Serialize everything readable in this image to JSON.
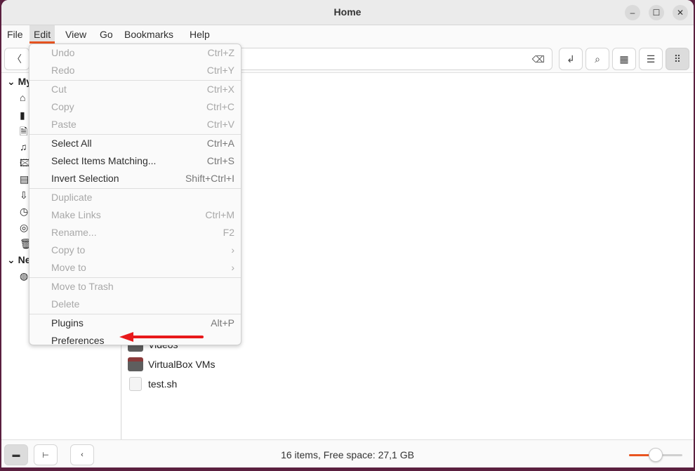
{
  "window": {
    "title": "Home"
  },
  "window_controls": {
    "minimize": "–",
    "maximize": "☐",
    "close": "✕"
  },
  "menubar": [
    "File",
    "Edit",
    "View",
    "Go",
    "Bookmarks",
    "Help"
  ],
  "active_menu": "Edit",
  "toolbar": {
    "back": "〈",
    "clear": "⌫",
    "open_terminal": "↲",
    "search": "⌕",
    "icon_view": "▦",
    "list_view": "☰",
    "compact_view": "⠿"
  },
  "sidebar": {
    "sections": [
      "My Computer",
      "Network"
    ],
    "section_short": [
      "My",
      "Ne"
    ],
    "icons": [
      "⌂",
      "▮",
      "🗎",
      "♫",
      "🖾",
      "▤",
      "⇩",
      "◷",
      "◎",
      "🗑"
    ],
    "network_icon": "◍"
  },
  "edit_menu": {
    "groups": [
      [
        {
          "label": "Undo",
          "accel": "Ctrl+Z",
          "enabled": false
        },
        {
          "label": "Redo",
          "accel": "Ctrl+Y",
          "enabled": false
        }
      ],
      [
        {
          "label": "Cut",
          "accel": "Ctrl+X",
          "enabled": false
        },
        {
          "label": "Copy",
          "accel": "Ctrl+C",
          "enabled": false
        },
        {
          "label": "Paste",
          "accel": "Ctrl+V",
          "enabled": false
        }
      ],
      [
        {
          "label": "Select All",
          "accel": "Ctrl+A",
          "enabled": true
        },
        {
          "label": "Select Items Matching...",
          "accel": "Ctrl+S",
          "enabled": true
        },
        {
          "label": "Invert Selection",
          "accel": "Shift+Ctrl+I",
          "enabled": true
        }
      ],
      [
        {
          "label": "Duplicate",
          "accel": "",
          "enabled": false
        },
        {
          "label": "Make Links",
          "accel": "Ctrl+M",
          "enabled": false
        },
        {
          "label": "Rename...",
          "accel": "F2",
          "enabled": false
        },
        {
          "label": "Copy to",
          "accel": "›",
          "enabled": false
        },
        {
          "label": "Move to",
          "accel": "›",
          "enabled": false
        }
      ],
      [
        {
          "label": "Move to Trash",
          "accel": "",
          "enabled": false
        },
        {
          "label": "Delete",
          "accel": "",
          "enabled": false
        }
      ],
      [
        {
          "label": "Plugins",
          "accel": "Alt+P",
          "enabled": true
        },
        {
          "label": "Preferences",
          "accel": "",
          "enabled": true
        }
      ]
    ]
  },
  "files": [
    {
      "name": "Videos",
      "type": "folder"
    },
    {
      "name": "VirtualBox VMs",
      "type": "folder"
    },
    {
      "name": "test.sh",
      "type": "script"
    }
  ],
  "statusbar": {
    "text": "16 items, Free space: 27,1 GB",
    "zoom_fraction": 0.5
  },
  "colors": {
    "accent": "#e95420",
    "annotation_arrow": "#e8191b"
  }
}
